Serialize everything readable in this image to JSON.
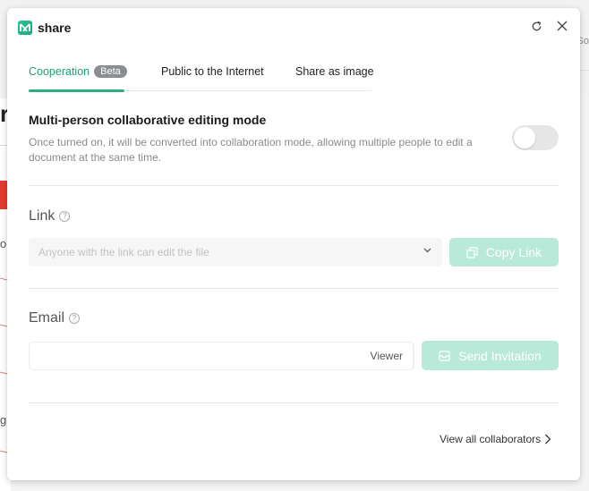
{
  "background": {
    "left_fragment": "r",
    "left_text_1": "o",
    "left_text_2": "g",
    "right_text": "So"
  },
  "dialog": {
    "title": "share",
    "logo_icon": "mindmap-logo-icon",
    "refresh_icon": "refresh-icon",
    "close_icon": "close-icon"
  },
  "tabs": [
    {
      "label": "Cooperation",
      "badge": "Beta",
      "active": true
    },
    {
      "label": "Public to the Internet",
      "active": false
    },
    {
      "label": "Share as image",
      "active": false
    }
  ],
  "collaboration": {
    "title": "Multi-person collaborative editing mode",
    "description": "Once turned on, it will be converted into collaboration mode, allowing multiple people to edit a document at the same time.",
    "toggle_on": false
  },
  "link": {
    "label": "Link",
    "help_icon": "question-circle-icon",
    "permission_select": "Anyone with the link can edit the file",
    "copy_button": "Copy Link"
  },
  "email": {
    "label": "Email",
    "help_icon": "question-circle-icon",
    "input_value": "",
    "input_placeholder": "",
    "role_select": "Viewer",
    "send_button": "Send Invitation"
  },
  "footer": {
    "view_all_link": "View all collaborators"
  },
  "colors": {
    "accent": "#1f9c76",
    "button_disabled": "#b9e9d9",
    "badge": "#8a8d91"
  }
}
